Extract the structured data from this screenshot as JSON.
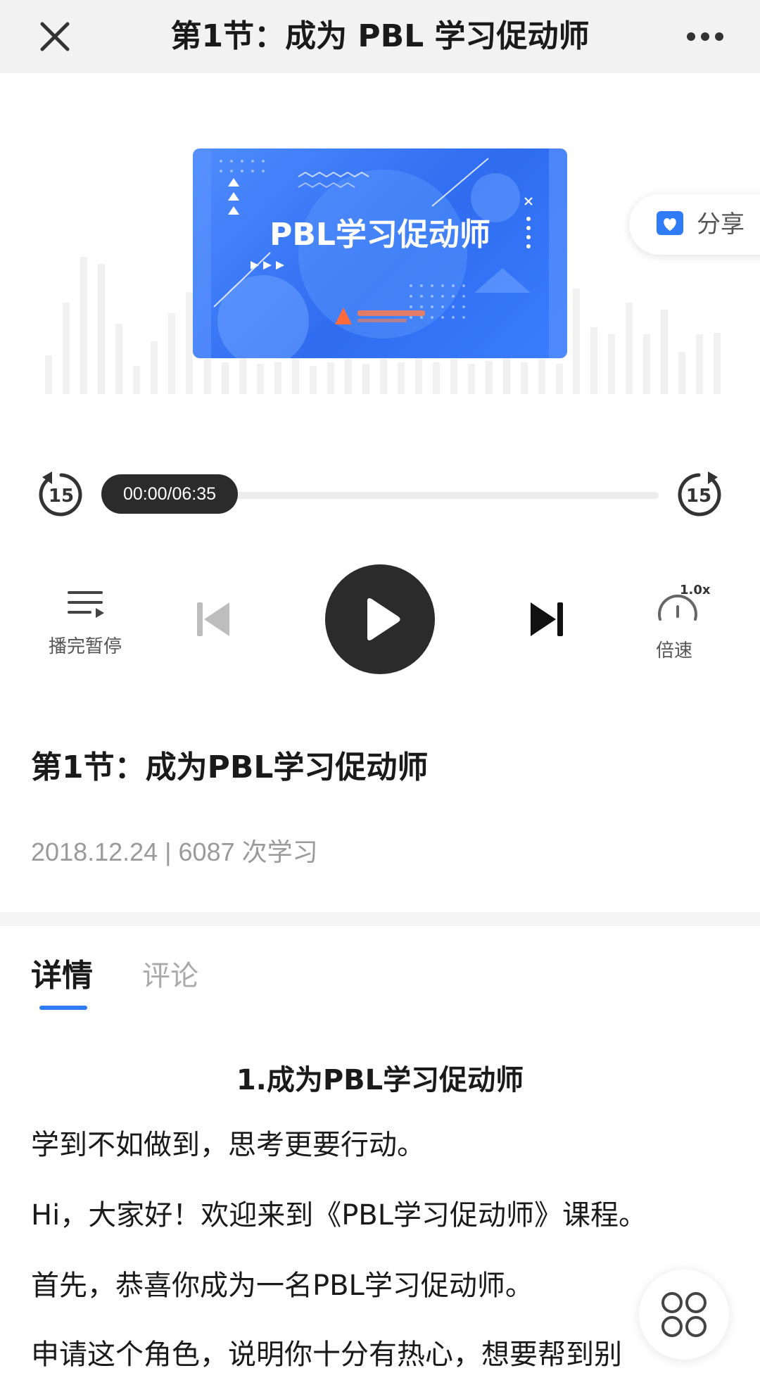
{
  "header": {
    "title": "第1节：成为 PBL 学习促动师",
    "close_icon": "close-icon",
    "more_icon": "more-horizontal-icon"
  },
  "cover": {
    "title": "PBL学习促动师",
    "logo_icon": "publisher-logo"
  },
  "share": {
    "label": "分享",
    "icon": "share-heart-icon"
  },
  "player": {
    "time": "00:00/06:35",
    "progress": 0,
    "rewind_seconds": "15",
    "forward_seconds": "15",
    "autopause_label": "播完暂停",
    "speed_label": "倍速",
    "speed_value": "1.0x"
  },
  "lesson": {
    "title": "第1节：成为PBL学习促动师",
    "meta": "2018.12.24 | 6087 次学习"
  },
  "tabs": [
    {
      "label": "详情",
      "active": true
    },
    {
      "label": "评论",
      "active": false
    }
  ],
  "article": {
    "heading": "1.成为PBL学习促动师",
    "paragraphs": [
      "学到不如做到，思考更要行动。",
      "Hi，大家好！欢迎来到《PBL学习促动师》课程。",
      "首先，恭喜你成为一名PBL学习促动师。",
      "申请这个角色，说明你十分有热心，想要帮到别"
    ]
  },
  "colors": {
    "accent": "#2f7cf6",
    "cover_blue": "#3a78f2",
    "play_dark": "#2b2b2b"
  }
}
